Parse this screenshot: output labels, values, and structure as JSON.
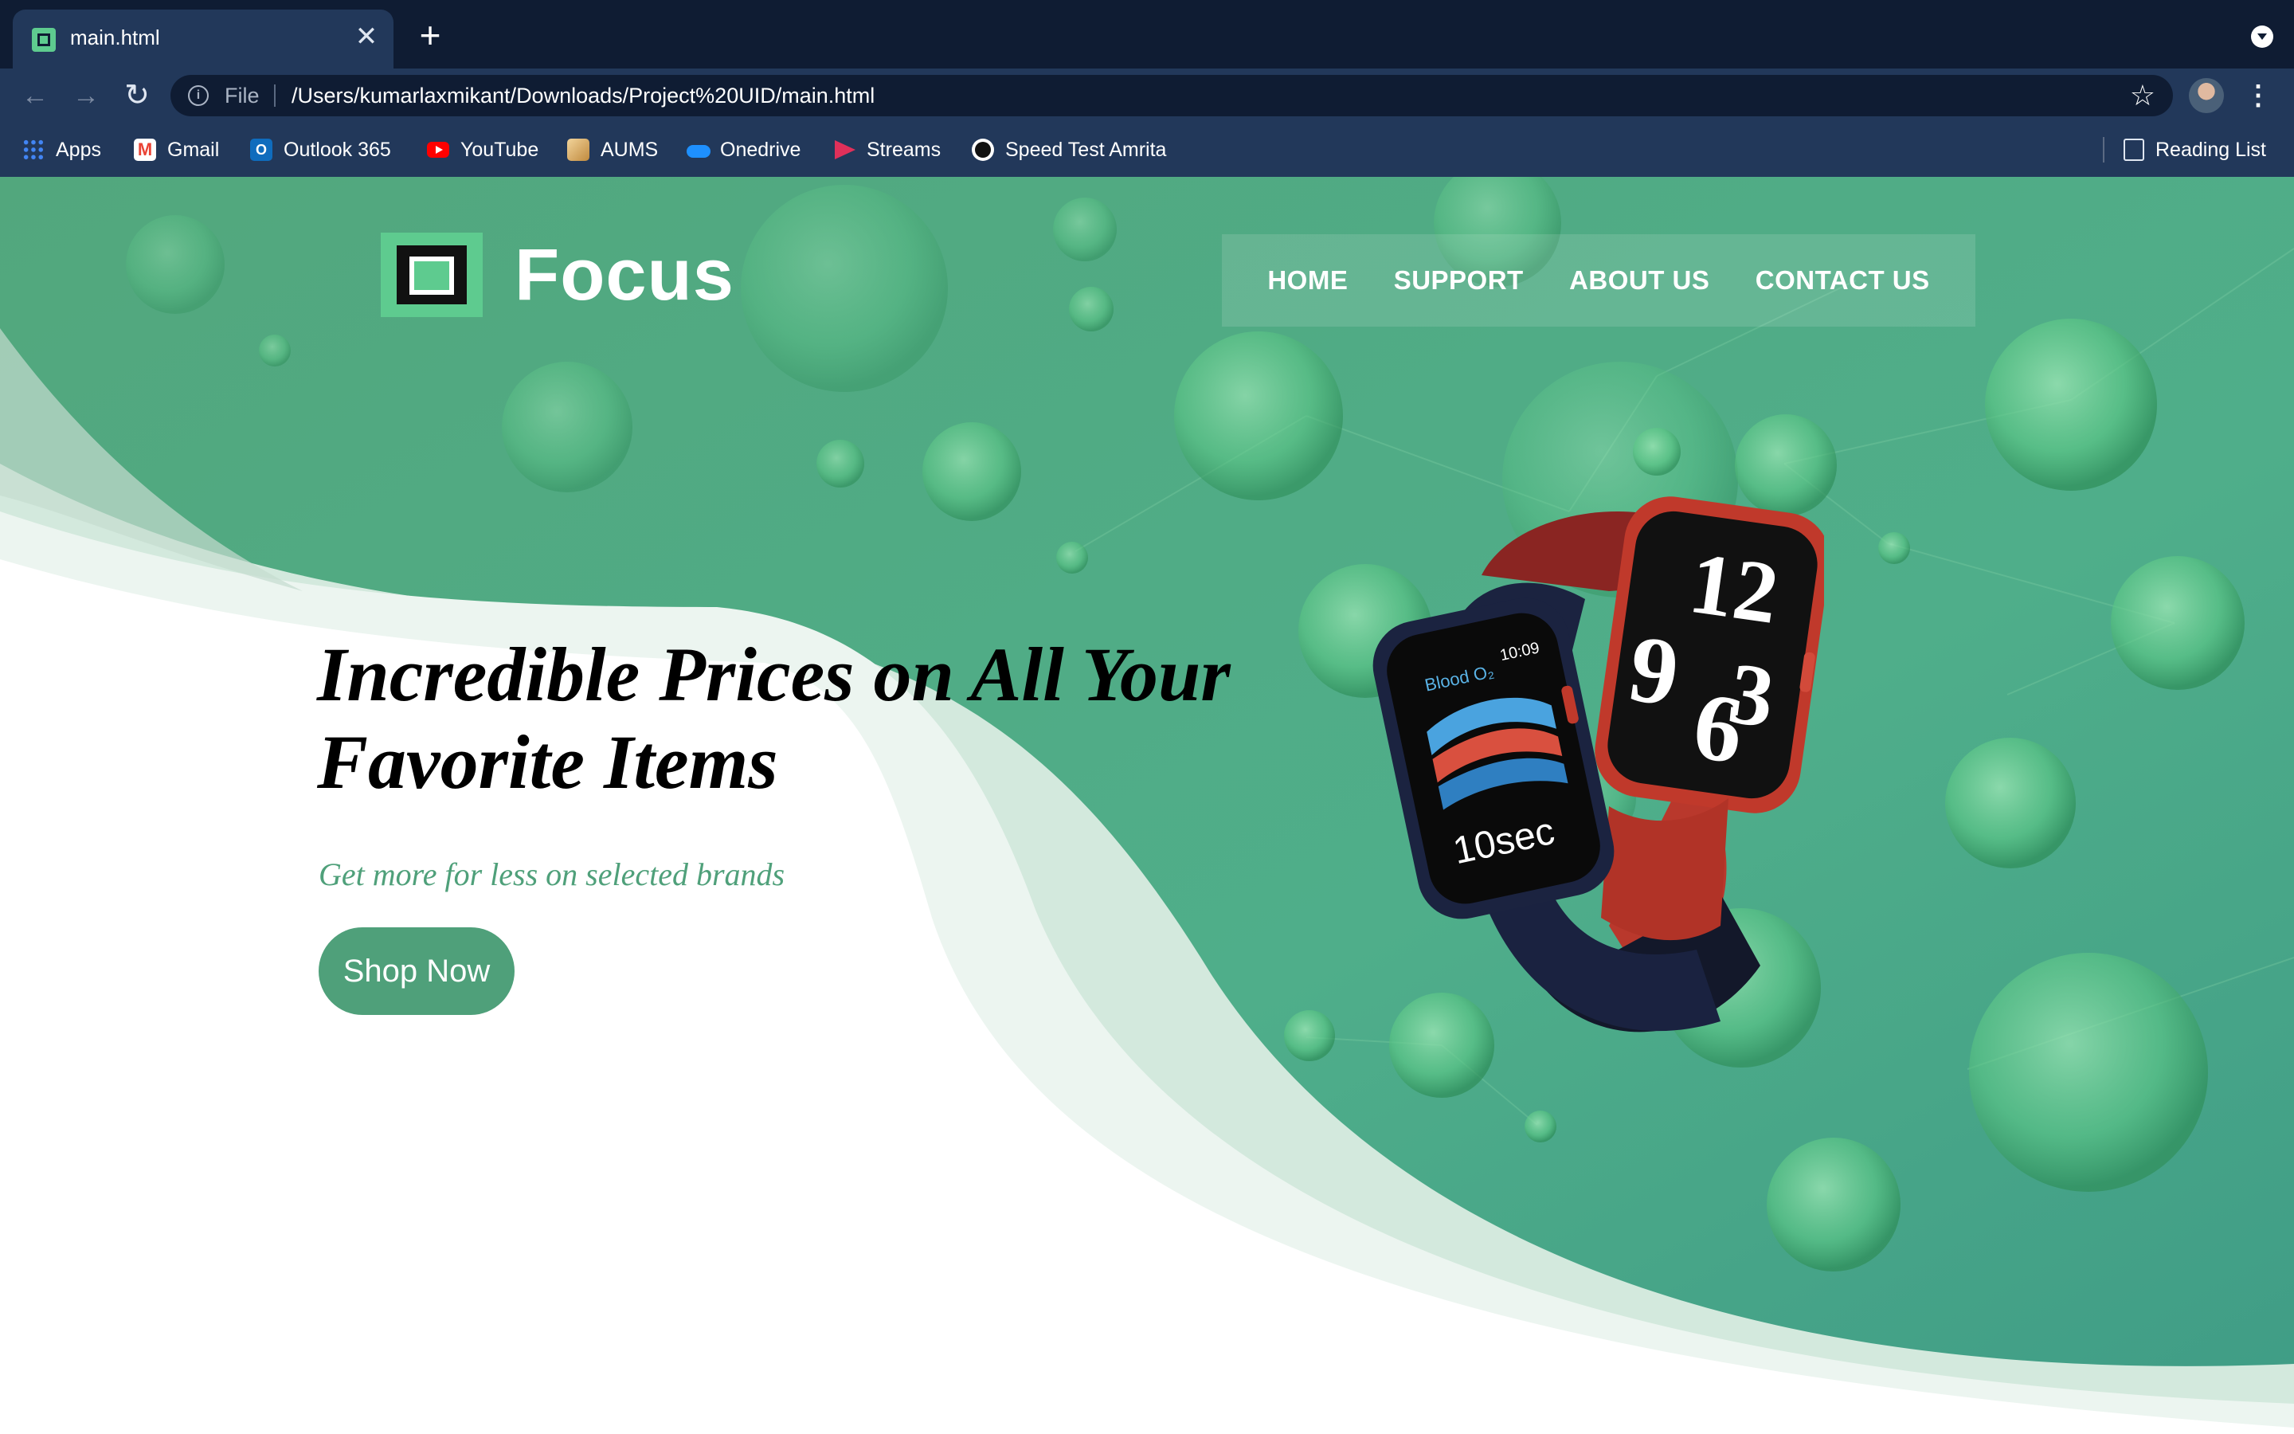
{
  "browser": {
    "tab": {
      "title": "main.html",
      "close_glyph": "✕"
    },
    "new_tab_glyph": "+",
    "toolbar": {
      "back_glyph": "←",
      "forward_glyph": "→",
      "reload_glyph": "↻",
      "info_glyph": "i",
      "scheme_label": "File",
      "url": "/Users/kumarlaxmikant/Downloads/Project%20UID/main.html",
      "star_glyph": "☆",
      "menu_glyph": "⋮"
    },
    "bookmarks": [
      {
        "label": "Apps",
        "icon": "apps-grid-icon"
      },
      {
        "label": "Gmail",
        "icon": "gmail-icon"
      },
      {
        "label": "Outlook 365",
        "icon": "outlook-icon"
      },
      {
        "label": "YouTube",
        "icon": "youtube-icon"
      },
      {
        "label": "AUMS",
        "icon": "aums-icon"
      },
      {
        "label": "Onedrive",
        "icon": "onedrive-icon"
      },
      {
        "label": "Streams",
        "icon": "streams-icon"
      },
      {
        "label": "Speed Test Amrita",
        "icon": "speedtest-icon"
      }
    ],
    "reading_list": {
      "label": "Reading List",
      "icon": "reading-list-icon"
    }
  },
  "site": {
    "brand": {
      "name": "Focus",
      "icon": "focus-logo-icon"
    },
    "nav": [
      "HOME",
      "SUPPORT",
      "ABOUT US",
      "CONTACT US"
    ],
    "hero": {
      "headline": "Incredible Prices on All Your Favorite Items",
      "subheadline": "Get more for less on selected brands",
      "cta_label": "Shop Now",
      "product_image": "smartwatch-image",
      "watch_screen_1": {
        "small_label": "Blood O₂",
        "time": "10:09",
        "reading": "10sec"
      },
      "watch_screen_2": {
        "numerals": [
          "12",
          "9",
          "6",
          "3"
        ]
      }
    },
    "colors": {
      "brand_green": "#5ecb8f",
      "accent_green": "#4fa07a",
      "hero_green": "#4ea882",
      "chrome_dark": "#0f1c33",
      "chrome_mid": "#22385a"
    }
  }
}
